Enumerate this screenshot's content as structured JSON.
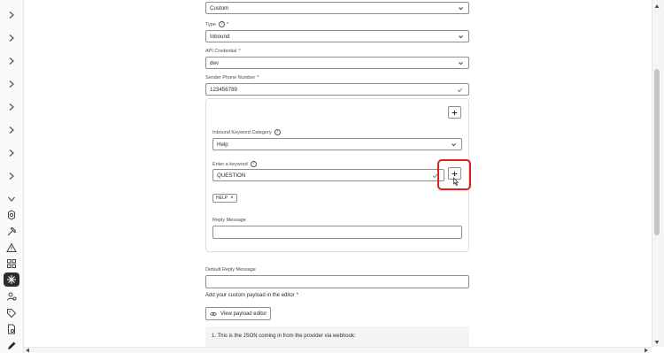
{
  "form": {
    "top_select_value": "Custom",
    "type_label": "Type",
    "type_value": "Inbound",
    "api_label": "API Credential",
    "api_value": "dev",
    "sender_label": "Sender Phone Number",
    "sender_value": "123456789",
    "required_mark": "*"
  },
  "card": {
    "category_label": "Inbound Keyword Category",
    "category_value": "Help",
    "keyword_label": "Enter a keyword",
    "keyword_value": "QUESTION",
    "tag_label": "HELP",
    "tag_remove": "×",
    "reply_label": "Reply Message",
    "reply_value": ""
  },
  "default_reply_label": "Default Reply Message",
  "default_reply_value": "",
  "payload_label": "Add your custom payload in the editor",
  "view_payload_button": "View payload editor",
  "json_note": "1. This is the JSON coming in from the provider via webhook:",
  "colors": {
    "highlight": "#e01e1e",
    "check": "#2d9d78",
    "active_nav": "#2c2c2c"
  },
  "icons": {
    "sidebar": [
      "chevron-right-icon",
      "chevron-right-icon",
      "chevron-right-icon",
      "chevron-right-icon",
      "chevron-right-icon",
      "chevron-right-icon",
      "chevron-right-icon",
      "chevron-right-icon",
      "chevron-down-icon",
      "settings-icon",
      "hammer-icon",
      "alert-icon",
      "workflow-icon",
      "integration-icon",
      "users-icon",
      "tag-icon",
      "document-icon",
      "edit-icon"
    ]
  }
}
